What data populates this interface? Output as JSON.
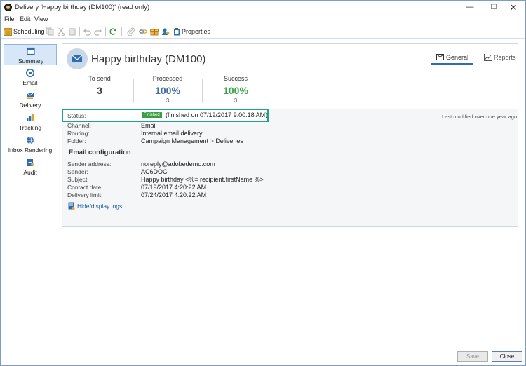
{
  "window": {
    "title": "Delivery 'Happy birthday (DM100)' (read only)",
    "controls": {
      "minimize": "—",
      "maximize": "☐",
      "close": "✕"
    }
  },
  "menu": {
    "file": "File",
    "edit": "Edit",
    "view": "View"
  },
  "toolbar": {
    "scheduling": "Scheduling",
    "properties": "Properties"
  },
  "sidebar": {
    "items": [
      {
        "label": "Summary",
        "icon": "summary-icon"
      },
      {
        "label": "Email",
        "icon": "email-icon"
      },
      {
        "label": "Delivery",
        "icon": "delivery-icon"
      },
      {
        "label": "Tracking",
        "icon": "tracking-icon"
      },
      {
        "label": "Inbox Rendering",
        "icon": "inbox-rendering-icon"
      },
      {
        "label": "Audit",
        "icon": "audit-icon"
      }
    ]
  },
  "header": {
    "title": "Happy birthday (DM100)"
  },
  "tabs": {
    "general": "General",
    "reports": "Reports"
  },
  "stats": {
    "to_send": {
      "label": "To send",
      "value": "3"
    },
    "processed": {
      "label": "Processed",
      "value": "100%",
      "sub": "3"
    },
    "success": {
      "label": "Success",
      "value": "100%",
      "sub": "3"
    }
  },
  "status": {
    "label": "Status:",
    "badge": "Finished",
    "text": "(finished on 07/19/2017 9:00:18 AM)"
  },
  "last_modified": "Last modified over one year ago",
  "details": {
    "channel": {
      "label": "Channel:",
      "value": "Email"
    },
    "routing": {
      "label": "Routing:",
      "value": "Internal email delivery"
    },
    "folder": {
      "label": "Folder:",
      "value": "Campaign Management > Deliveries"
    }
  },
  "email_config": {
    "title": "Email configuration",
    "sender_address": {
      "label": "Sender address:",
      "value": "noreply@adobedemo.com"
    },
    "sender": {
      "label": "Sender:",
      "value": "AC6DOC"
    },
    "subject": {
      "label": "Subject:",
      "value": "Happy birthday <%= recipient.firstName %>"
    },
    "contact_date": {
      "label": "Contact date:",
      "value": "07/19/2017 4:20:22 AM"
    },
    "delivery_limit": {
      "label": "Delivery limit:",
      "value": "07/24/2017 4:20:22 AM"
    }
  },
  "logs_link": "Hide/display logs",
  "buttons": {
    "save": "Save",
    "close": "Close"
  },
  "colors": {
    "accent": "#2c6eb5",
    "success": "#3da34a",
    "processed": "#3e6da1",
    "status_highlight": "#1aa58a",
    "badge": "#3a9d44"
  }
}
